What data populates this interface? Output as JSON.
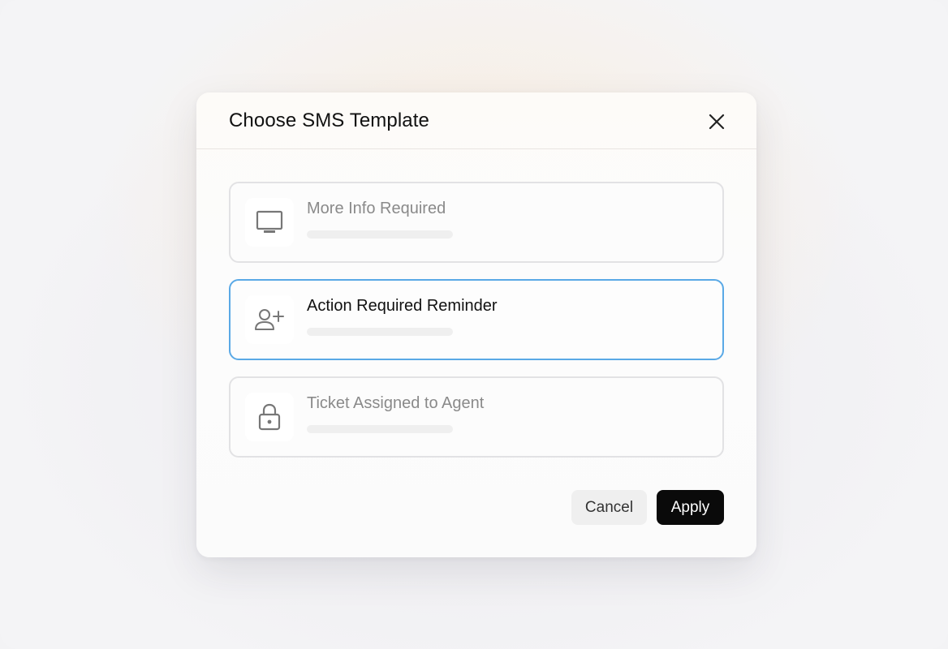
{
  "dialog": {
    "title": "Choose SMS Template",
    "close_icon": "close-icon"
  },
  "templates": [
    {
      "title": "More Info Required",
      "icon": "monitor-icon",
      "selected": false
    },
    {
      "title": "Action Required Reminder",
      "icon": "user-plus-icon",
      "selected": true
    },
    {
      "title": "Ticket Assigned to Agent",
      "icon": "lock-icon",
      "selected": false
    }
  ],
  "footer": {
    "cancel_label": "Cancel",
    "apply_label": "Apply"
  },
  "colors": {
    "selected_border": "#5aa9e6",
    "apply_bg": "#0a0a0a",
    "cancel_bg": "#efefef"
  }
}
